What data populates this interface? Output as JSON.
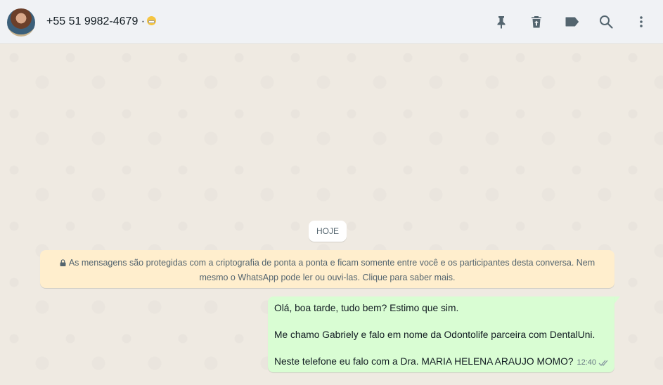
{
  "header": {
    "contact_name": "+55 51 9982-4679 ·",
    "avatar_alt": "avatar",
    "icons": [
      "pin-icon",
      "delete-icon",
      "label-icon",
      "search-icon",
      "menu-icon"
    ]
  },
  "chat": {
    "date_chip": "HOJE",
    "encryption_notice": "As mensagens são protegidas com a criptografia de ponta a ponta e ficam somente entre você e os participantes desta conversa. Nem mesmo o WhatsApp pode ler ou ouvi-las. Clique para saber mais.",
    "message": {
      "lines": [
        "Olá, boa tarde, tudo bem? Estimo que sim.",
        "Me chamo Gabriely e falo em nome da Odontolife parceira com DentalUni.",
        "Neste telefone eu falo com a Dra. MARIA HELENA ARAUJO MOMO?"
      ],
      "time": "12:40",
      "status": "double-check-icon"
    }
  },
  "colors": {
    "header_bg": "#f0f2f5",
    "chat_bg": "#efeae2",
    "outgoing_bubble": "#d9fdd3",
    "notice_bg": "#ffeecd",
    "icon_color": "#54656f"
  }
}
